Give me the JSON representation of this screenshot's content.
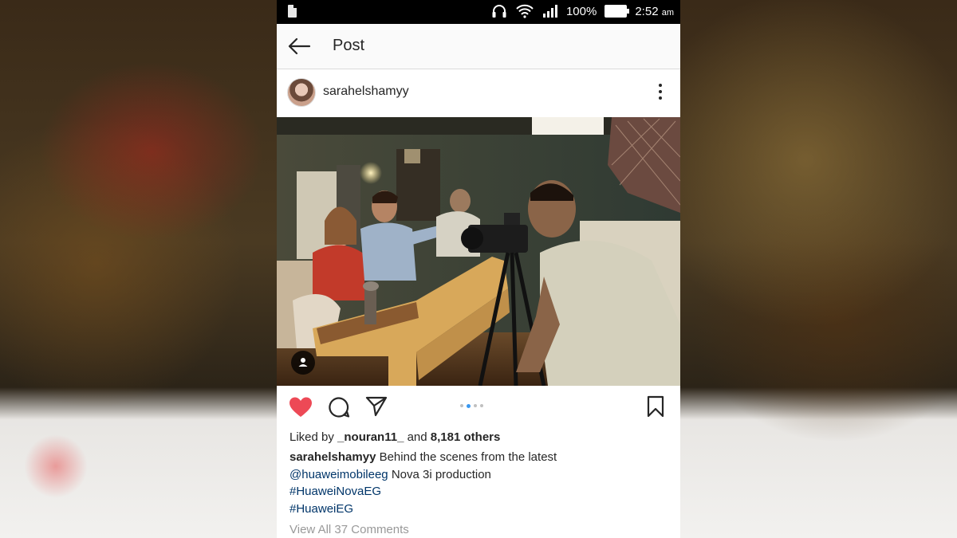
{
  "status_bar": {
    "battery_percent": "100%",
    "time": "2:52",
    "time_suffix": "am",
    "icons": [
      "sim-card-icon",
      "headset-icon",
      "wifi-icon",
      "signal-icon",
      "battery-icon"
    ]
  },
  "header": {
    "back_icon": "back-arrow-icon",
    "title": "Post"
  },
  "post": {
    "username": "sarahelshamyy",
    "more_icon": "more-vertical-icon",
    "photo_description_icon": "tagged-people-icon",
    "actions": {
      "liked": true,
      "like_color": "#ed4956",
      "icons": [
        "heart-icon",
        "comment-icon",
        "share-icon",
        "bookmark-icon"
      ],
      "carousel": {
        "count": 4,
        "active_index": 1
      }
    },
    "likes": {
      "prefix": "Liked by",
      "liker": "_nouran11_",
      "connector": "and",
      "others": "8,181 others"
    },
    "caption": {
      "username": "sarahelshamyy",
      "line1_text": "Behind the scenes from the latest",
      "mention": "@huaweimobileeg",
      "line2_text": "Nova 3i production",
      "hashtag1": "#HuaweiNovaEG",
      "hashtag2": "#HuaweiEG"
    },
    "view_comments": "View All 37 Comments"
  }
}
